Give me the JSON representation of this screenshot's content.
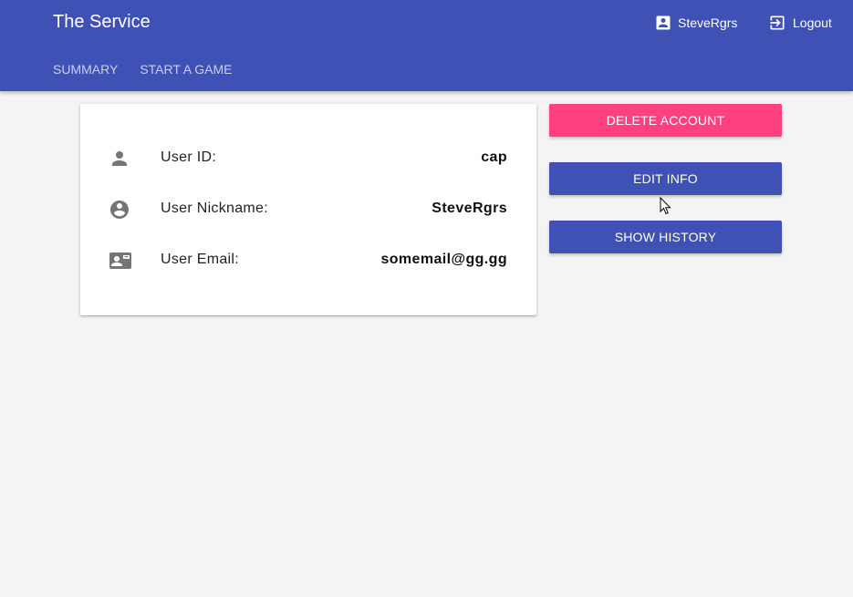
{
  "header": {
    "title": "The Service",
    "user_name": "SteveRgrs",
    "user_icon": "account-box-icon",
    "logout_label": "Logout",
    "logout_icon": "exit-to-app-icon",
    "background_color": "#3f51b5"
  },
  "nav": {
    "tabs": [
      {
        "label": "SUMMARY"
      },
      {
        "label": "START A GAME"
      }
    ]
  },
  "profile": {
    "rows": [
      {
        "icon": "person-icon",
        "label": "User ID:",
        "value": "cap"
      },
      {
        "icon": "account-circle-icon",
        "label": "User Nickname:",
        "value": "SteveRgrs"
      },
      {
        "icon": "contact-mail-icon",
        "label": "User Email:",
        "value": "somemail@gg.gg"
      }
    ]
  },
  "actions": {
    "delete_label": "DELETE ACCOUNT",
    "delete_color": "#ff4081",
    "edit_label": "EDIT INFO",
    "history_label": "SHOW HISTORY",
    "primary_color": "#3f51b5"
  }
}
